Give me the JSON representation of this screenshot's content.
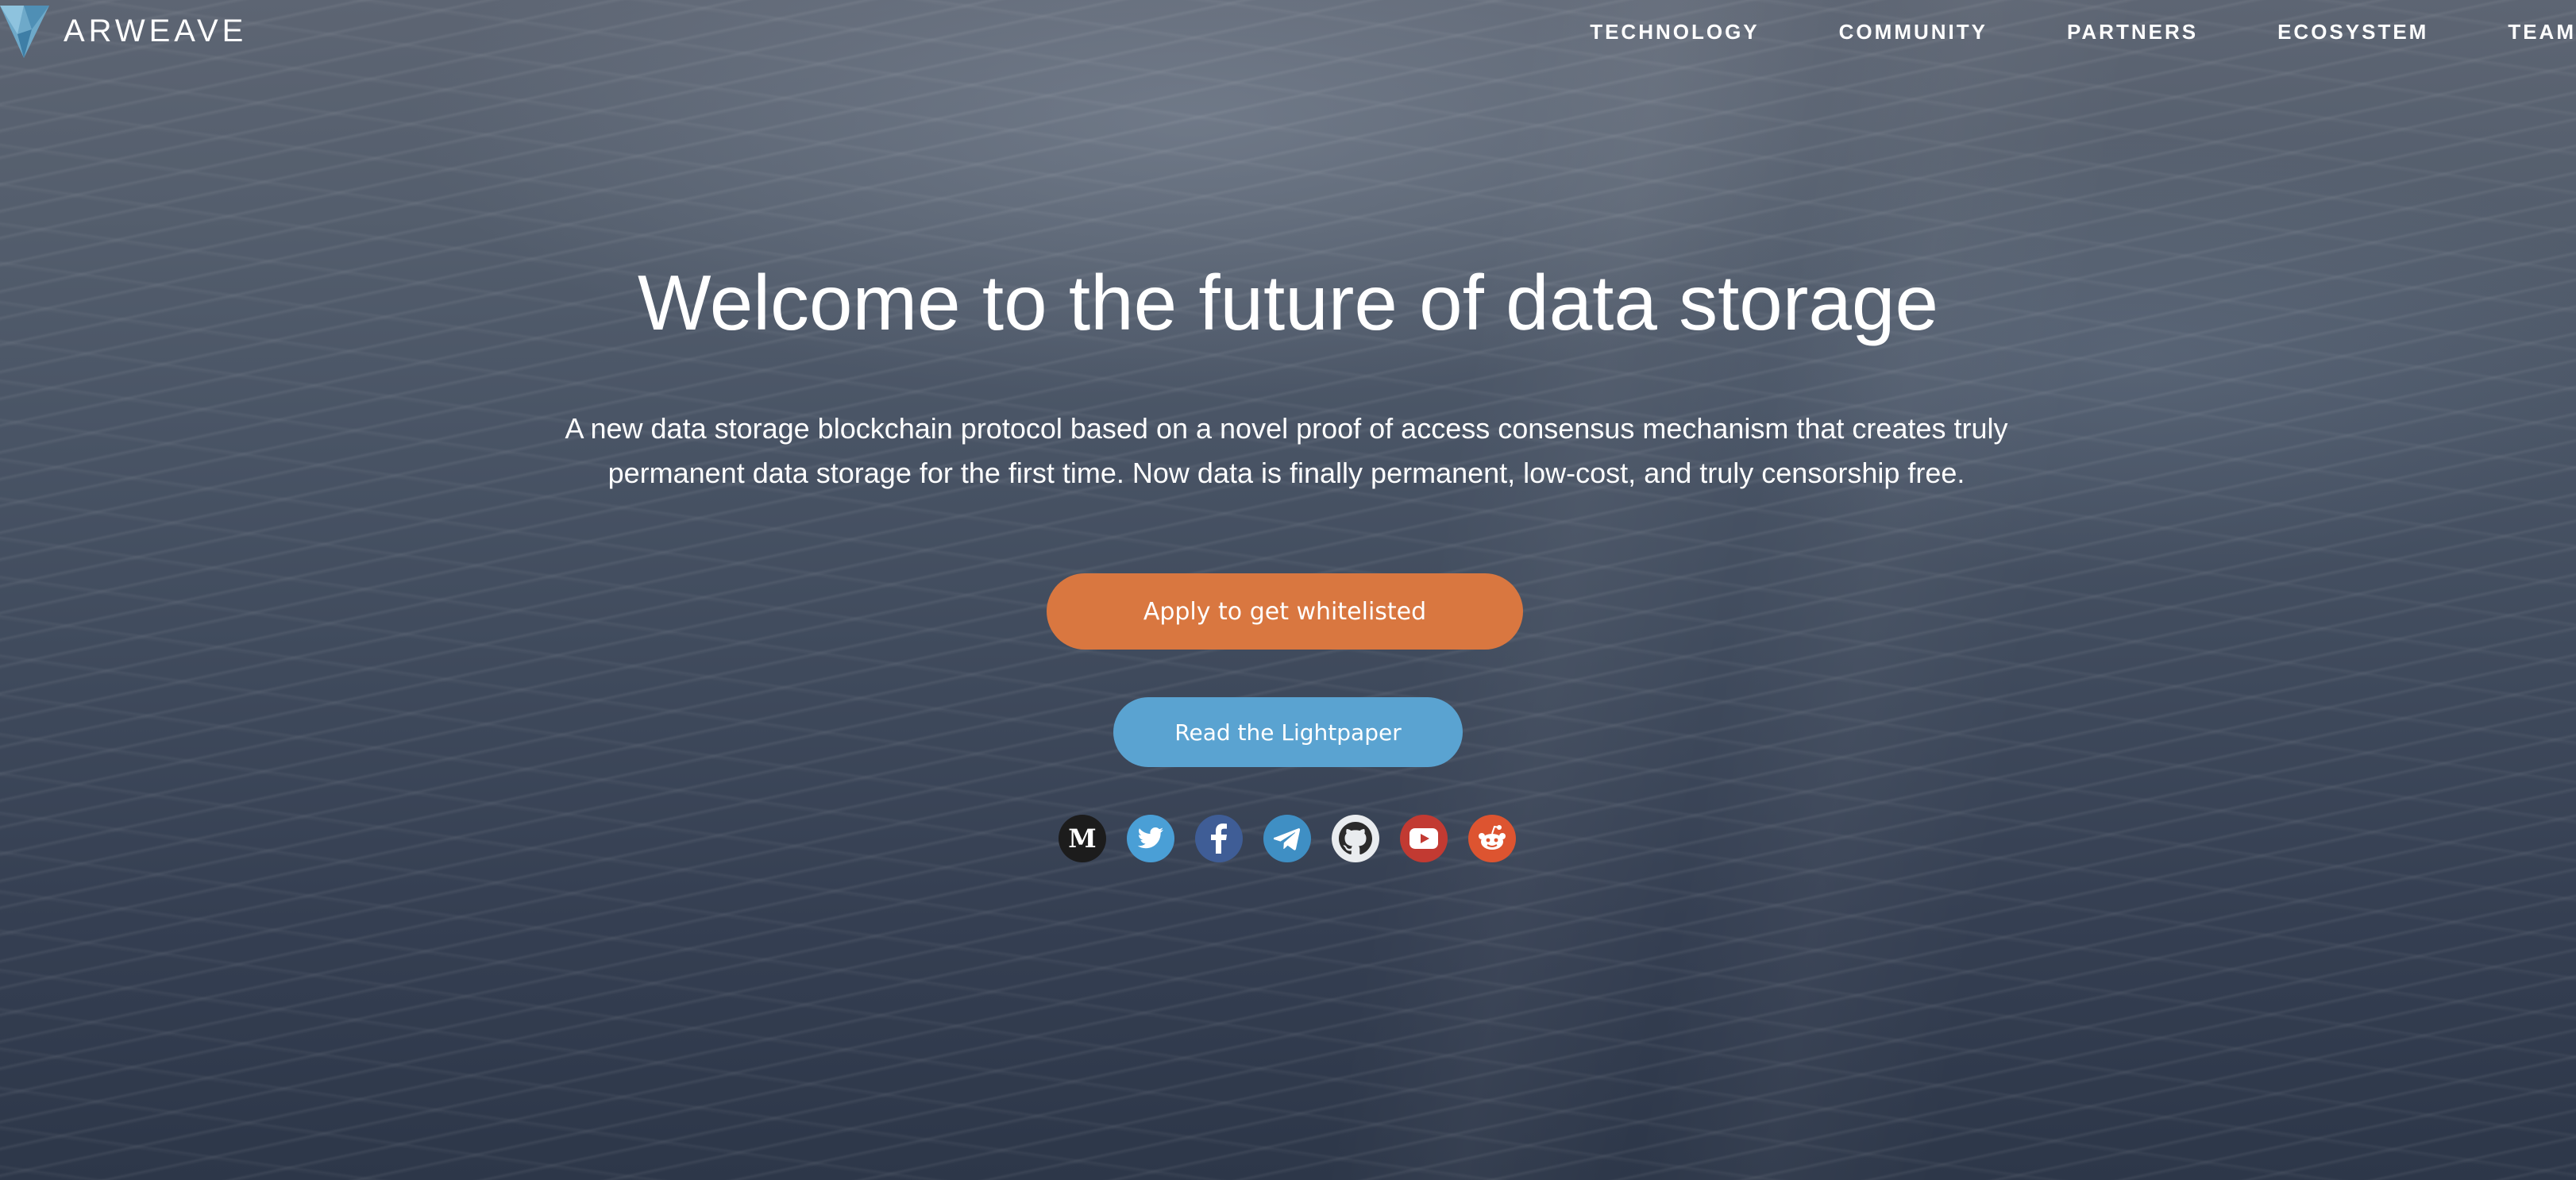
{
  "brand": {
    "name": "ARWEAVE",
    "logo_icon": "arweave-crystal-logo"
  },
  "nav": {
    "items": [
      {
        "label": "TECHNOLOGY"
      },
      {
        "label": "COMMUNITY"
      },
      {
        "label": "PARTNERS"
      },
      {
        "label": "ECOSYSTEM"
      },
      {
        "label": "TEAM"
      }
    ]
  },
  "hero": {
    "title": "Welcome to the future of data storage",
    "subtitle_line1": "A new data storage blockchain protocol based on a novel proof of access consensus mechanism that creates truly",
    "subtitle_line2": "permanent data storage for the first time. Now data is finally permanent, low-cost, and truly censorship free."
  },
  "buttons": {
    "apply_label": "Apply to get whitelisted",
    "apply_color": "#d97740",
    "lightpaper_label": "Read the Lightpaper",
    "lightpaper_color": "#5aa3d1"
  },
  "social": [
    {
      "icon": "medium-icon",
      "color": "#1c1c1c"
    },
    {
      "icon": "twitter-icon",
      "color": "#4a9fd6"
    },
    {
      "icon": "facebook-icon",
      "color": "#3f5d96"
    },
    {
      "icon": "telegram-icon",
      "color": "#3f8fc4"
    },
    {
      "icon": "github-icon",
      "color": "#2b2b2b"
    },
    {
      "icon": "youtube-icon",
      "color": "#c23a32"
    },
    {
      "icon": "reddit-icon",
      "color": "#dd5430"
    }
  ]
}
